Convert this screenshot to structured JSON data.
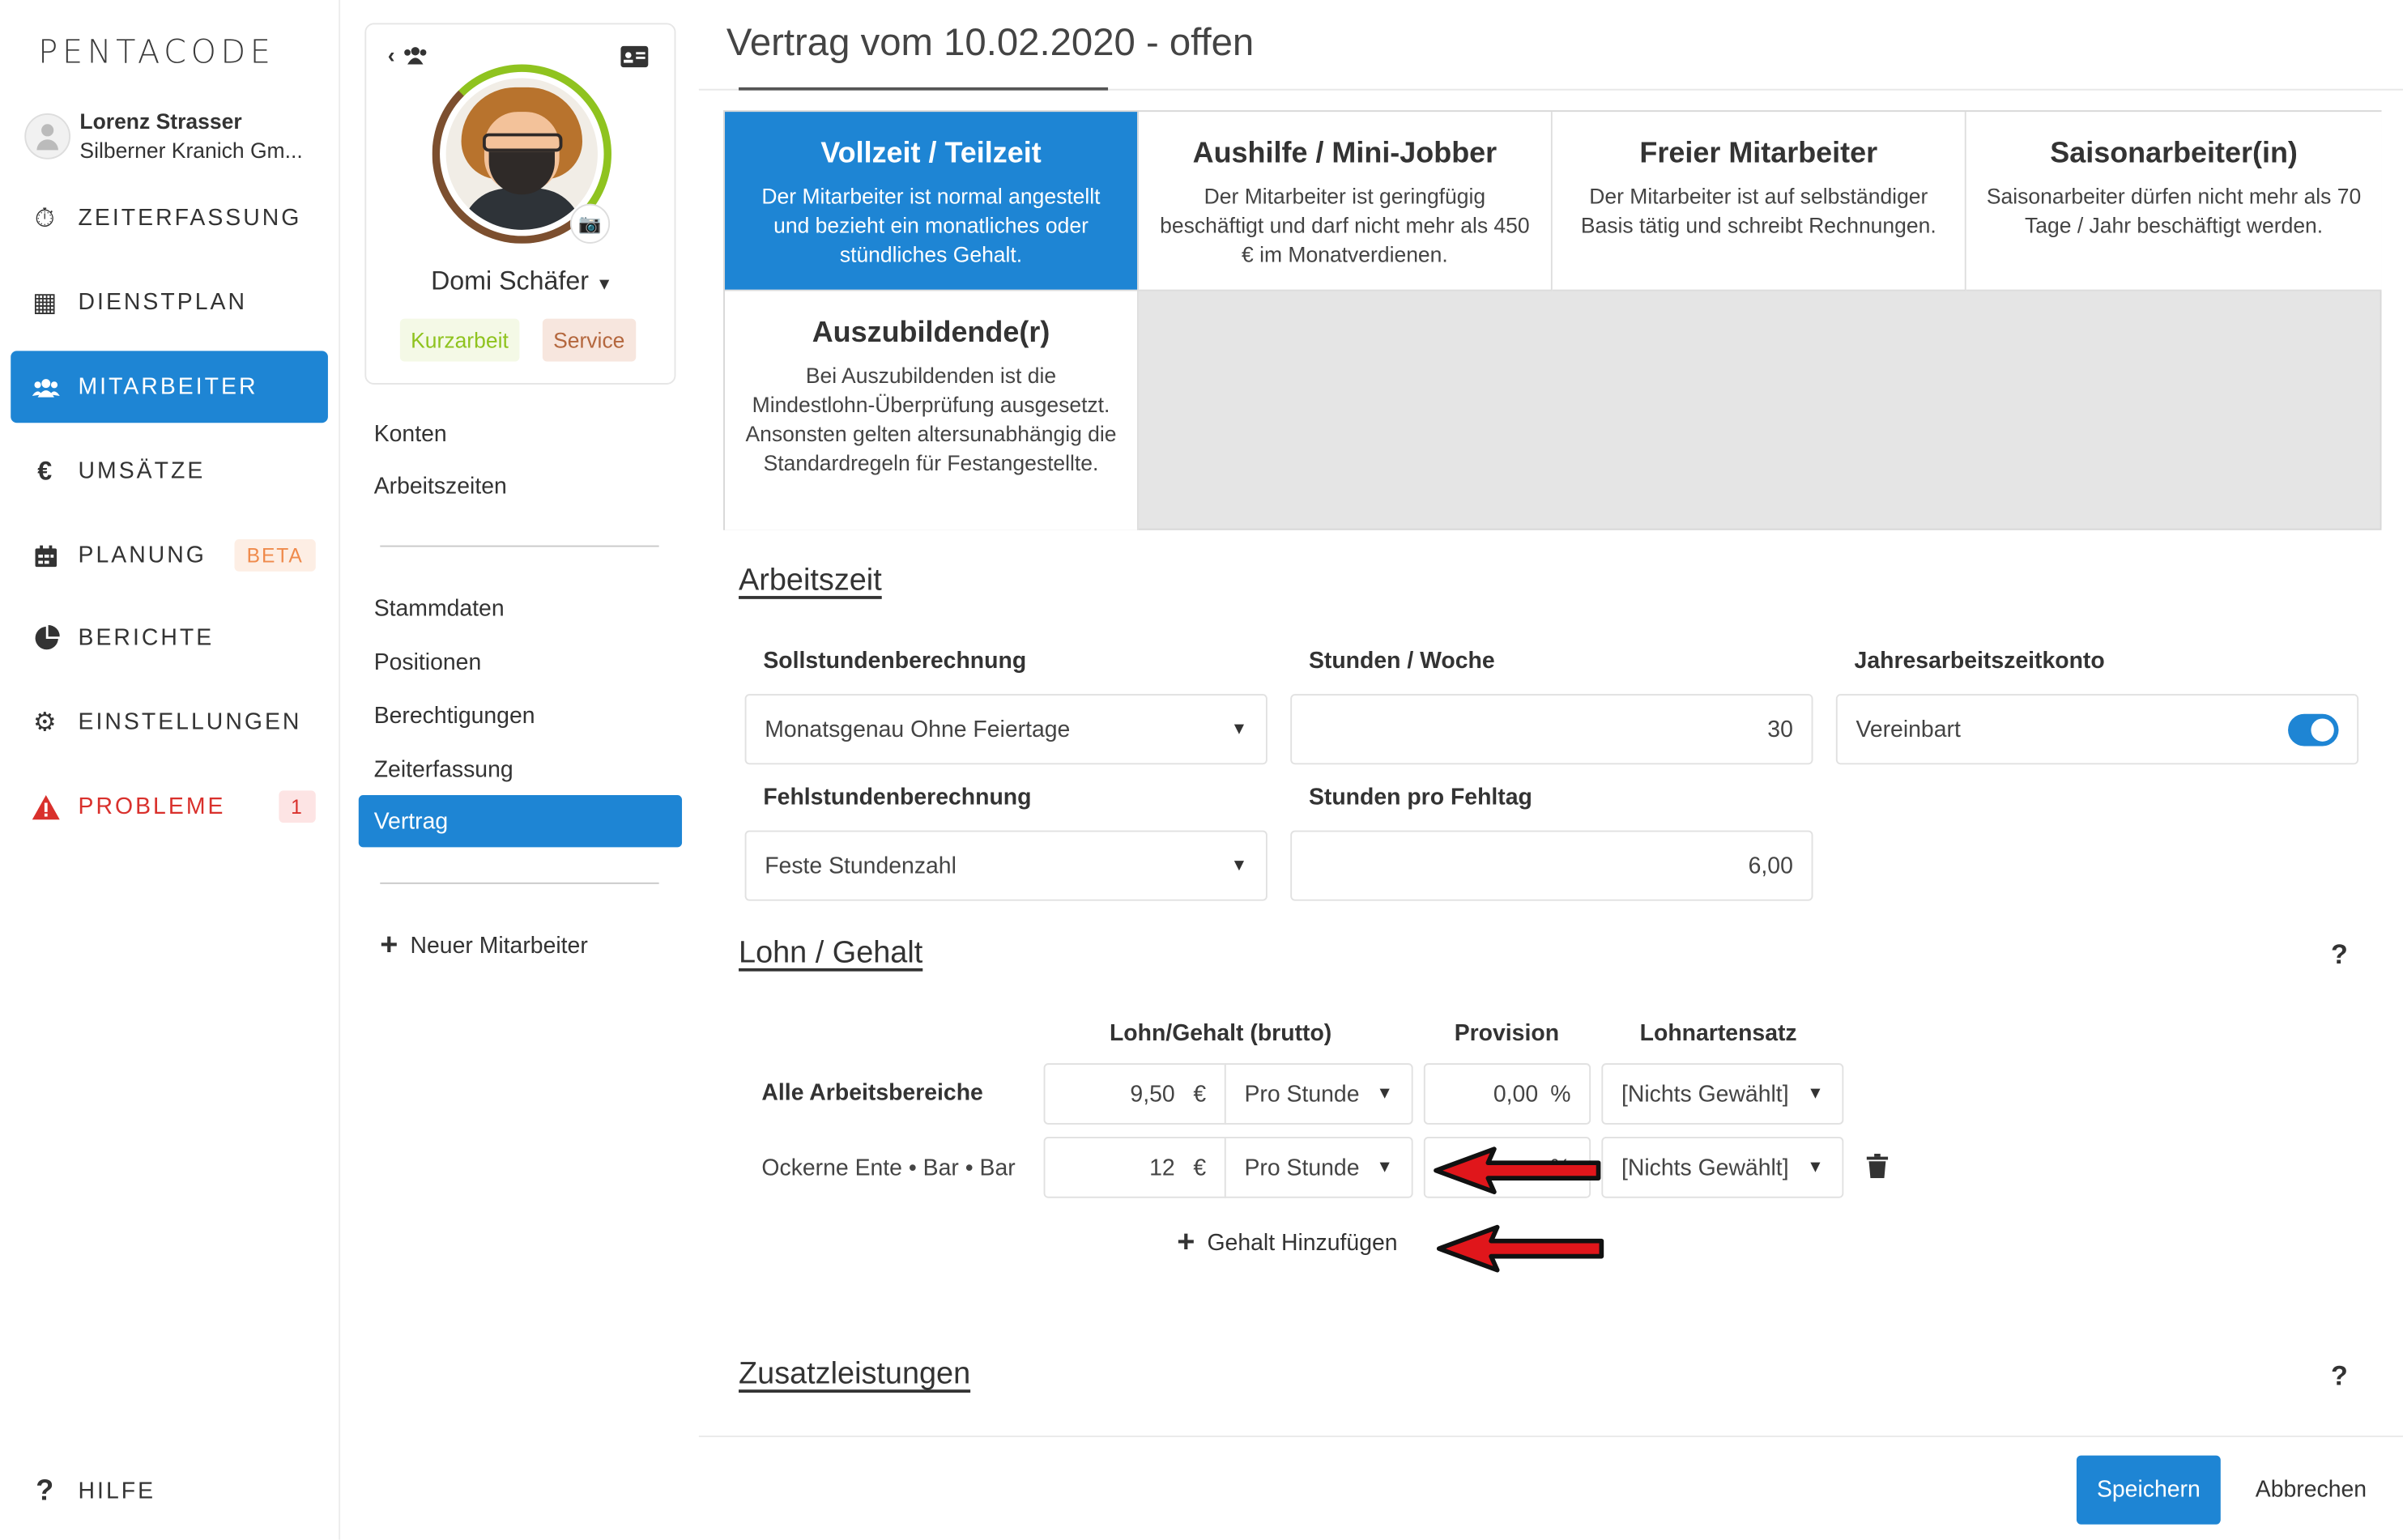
{
  "brand": "PENTACODE",
  "user": {
    "name": "Lorenz Strasser",
    "company": "Silberner Kranich Gm..."
  },
  "nav": [
    {
      "label": "ZEITERFASSUNG",
      "icon": "stopwatch-icon"
    },
    {
      "label": "DIENSTPLAN",
      "icon": "table-icon"
    },
    {
      "label": "MITARBEITER",
      "icon": "users-icon",
      "active": true
    },
    {
      "label": "UMSÄTZE",
      "icon": "euro-icon"
    },
    {
      "label": "PLANUNG",
      "icon": "calendar-icon",
      "badge": "BETA"
    },
    {
      "label": "BERICHTE",
      "icon": "pie-chart-icon"
    },
    {
      "label": "EINSTELLUNGEN",
      "icon": "gear-icon"
    },
    {
      "label": "PROBLEME",
      "icon": "warning-icon",
      "badge": "1"
    }
  ],
  "help_label": "HILFE",
  "employee": {
    "name": "Domi Schäfer",
    "tags": [
      "Kurzarbeit",
      "Service"
    ]
  },
  "subnav": {
    "group1": [
      "Konten",
      "Arbeitszeiten"
    ],
    "group2": [
      "Stammdaten",
      "Positionen",
      "Berechtigungen",
      "Zeiterfassung",
      "Vertrag"
    ],
    "active": "Vertrag",
    "new_employee": "Neuer Mitarbeiter"
  },
  "page_title": "Vertrag vom 10.02.2020 - offen",
  "contract_types": [
    {
      "title": "Vollzeit / Teilzeit",
      "text": "Der Mitarbeiter ist normal angestellt und bezieht ein monatliches oder stündliches Gehalt.",
      "selected": true
    },
    {
      "title": "Aushilfe / Mini-Jobber",
      "text": "Der Mitarbeiter ist geringfügig beschäftigt und darf nicht mehr als 450 € im Monatverdienen."
    },
    {
      "title": "Freier Mitarbeiter",
      "text": "Der Mitarbeiter ist auf selbständiger Basis tätig und schreibt Rechnungen."
    },
    {
      "title": "Saisonarbeiter(in)",
      "text": "Saisonarbeiter dürfen nicht mehr als 70 Tage / Jahr beschäftigt werden."
    },
    {
      "title": "Auszubildende(r)",
      "text": "Bei Auszubildenden ist die Mindestlohn-Überprüfung ausgesetzt. Ansonsten gelten altersunabhängig die Standardregeln für Festangestellte."
    }
  ],
  "arbeitszeit": {
    "section": "Arbeitszeit",
    "soll_label": "Sollstundenberechnung",
    "soll_value": "Monatsgenau Ohne Feiertage",
    "stunden_woche_label": "Stunden / Woche",
    "stunden_woche_value": "30",
    "jahres_label": "Jahresarbeitszeitkonto",
    "jahres_value": "Vereinbart",
    "jahres_on": true,
    "fehl_label": "Fehlstundenberechnung",
    "fehl_value": "Feste Stundenzahl",
    "fehltag_label": "Stunden pro Fehltag",
    "fehltag_value": "6,00"
  },
  "lohn": {
    "section": "Lohn / Gehalt",
    "help": "?",
    "col_lohn": "Lohn/Gehalt (brutto)",
    "col_provision": "Provision",
    "col_satz": "Lohnartensatz",
    "rows": [
      {
        "area": "Alle Arbeitsbereiche",
        "amount": "9,50",
        "currency": "€",
        "unit": "Pro Stunde",
        "provision": "0,00",
        "pct": "%",
        "satz": "[Nichts Gewählt]"
      },
      {
        "area": "Ockerne Ente • Bar • Bar",
        "amount": "12",
        "currency": "€",
        "unit": "Pro Stunde",
        "provision": "",
        "pct": "%",
        "satz": "[Nichts Gewählt]"
      }
    ],
    "add_label": "Gehalt Hinzufügen"
  },
  "zusatz": {
    "section": "Zusatzleistungen",
    "help": "?"
  },
  "buttons": {
    "save": "Speichern",
    "cancel": "Abbrechen"
  },
  "colors": {
    "accent": "#1e85d4",
    "danger": "#d9302c",
    "arrow": "#e0161b"
  }
}
